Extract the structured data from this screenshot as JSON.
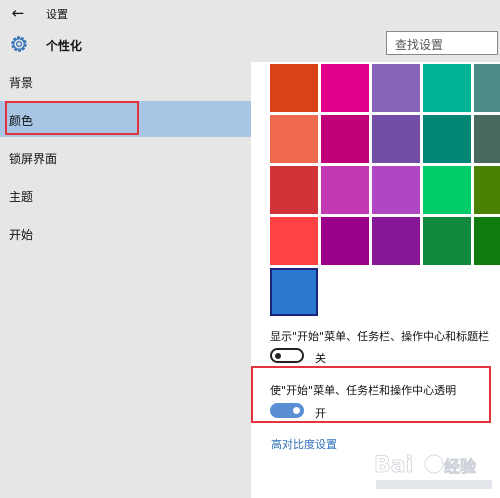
{
  "window": {
    "title": "设置"
  },
  "header": {
    "section_title": "个性化",
    "search_placeholder": "查找设置"
  },
  "sidebar": {
    "items": [
      {
        "label": "背景"
      },
      {
        "label": "颜色",
        "selected": true
      },
      {
        "label": "锁屏界面"
      },
      {
        "label": "主题"
      },
      {
        "label": "开始"
      }
    ]
  },
  "colors": {
    "grid": [
      [
        "#d84315",
        "#e3008c",
        "#8764b8",
        "#00b294",
        "#4a8a88"
      ],
      [
        "#ef6950",
        "#bf0077",
        "#744da9",
        "#018574",
        "#486860"
      ],
      [
        "#d13438",
        "#c239b3",
        "#b146c2",
        "#00cc6a",
        "#498205"
      ],
      [
        "#ff4343",
        "#9a0089",
        "#881798",
        "#10893e",
        "#107c10"
      ],
      [
        "#2b78d0"
      ]
    ],
    "selected": "#2b78d0"
  },
  "settings": {
    "show_color_label": "显示\"开始\"菜单、任务栏、操作中心和标题栏",
    "show_color_state": "关",
    "show_color_on": false,
    "transparency_label": "使\"开始\"菜单、任务栏和操作中心透明",
    "transparency_state": "开",
    "transparency_on": true,
    "high_contrast_link": "高对比度设置"
  },
  "theme": {
    "accent": "#5a8fd4",
    "highlight_red": "#e2343c",
    "link": "#2d6fb8",
    "sidebar_bg": "#e6e6e6",
    "selected_bg": "#a8c6e4"
  }
}
